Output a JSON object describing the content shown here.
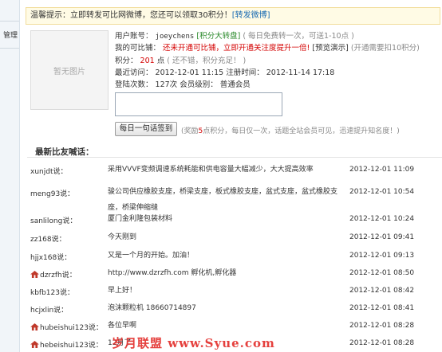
{
  "sidebar": {
    "manage_label": "管理"
  },
  "notice": {
    "text": "温馨提示：立即转发可比网微博，您还可以领取30积分！",
    "link": "[转发微博]"
  },
  "avatar": {
    "placeholder": "暂无图片"
  },
  "profile": {
    "account_label": "用户账号：",
    "account_value": "joeychens",
    "wheel_link": "[积分大转盘]",
    "wheel_hint": "( 每日免费转一次，可送1-10点 )",
    "cb_label": "我的可比铺：",
    "cb_value": "还未开通可比铺，立即开通关注度提升一倍!",
    "preview_link": "[预览演示]",
    "cb_hint": "(开通需要扣10积分)",
    "points_label": "积分：",
    "points_value": "201",
    "points_unit": "点",
    "points_hint": "( 还不错，积分充足！ )",
    "last_visit_label": "最近访问：",
    "last_visit_value": "2012-12-01 11:15",
    "register_label": "注册时间：",
    "register_value": "2012-11-14 17:18",
    "views_label": "登陆次数：",
    "views_value": "127次",
    "level_label": "会员级别：",
    "level_value": "普通会员"
  },
  "signin": {
    "button_label": "每日一句话签到",
    "hint_prefix": "(奖励",
    "hint_points": "5",
    "hint_suffix": "点积分，每日仅一次，话题全站会员可见，迅速提升知名度！)"
  },
  "feed": {
    "title": "最新比友喊话：",
    "items": [
      {
        "user": "xunjdt说：",
        "icon": false,
        "text": "采用VVVF变频调速系统耗能和供电容量大幅减少，大大提高效率",
        "time": "2012-12-01 11:09"
      },
      {
        "user": "meng93说：",
        "icon": false,
        "text": "骏公司供应橡胶支座，桥梁支座，板式橡胶支座，盆式支座，盆式橡胶支座，桥梁伸缩缝",
        "time": "2012-12-01 10:54"
      },
      {
        "user": "sanlilong说：",
        "icon": false,
        "text": "厦门金利隆包装材料",
        "time": "2012-12-01 10:24"
      },
      {
        "user": "zz168说：",
        "icon": false,
        "text": "今天刚到",
        "time": "2012-12-01 09:41"
      },
      {
        "user": "hjjx168说：",
        "icon": false,
        "text": "又是一个月的开始。加油！",
        "time": "2012-12-01 09:13"
      },
      {
        "user": "dzrzfh说：",
        "icon": true,
        "text": "http://www.dzrzfh.com 孵化机,孵化器",
        "time": "2012-12-01 08:50"
      },
      {
        "user": "kbfb123说：",
        "icon": false,
        "text": "早上好！",
        "time": "2012-12-01 08:42"
      },
      {
        "user": "hcjxlin说：",
        "icon": false,
        "text": "泡沫颗粒机 18660714897",
        "time": "2012-12-01 08:41"
      },
      {
        "user": "hubeishui123说：",
        "icon": true,
        "text": "各位早啊",
        "time": "2012-12-01 08:28"
      },
      {
        "user": "hebeishui123说：",
        "icon": true,
        "text": "12月了",
        "time": "2012-12-01 08:28"
      }
    ]
  },
  "watermark": {
    "text": "岁月联盟  www.Syue.com"
  }
}
